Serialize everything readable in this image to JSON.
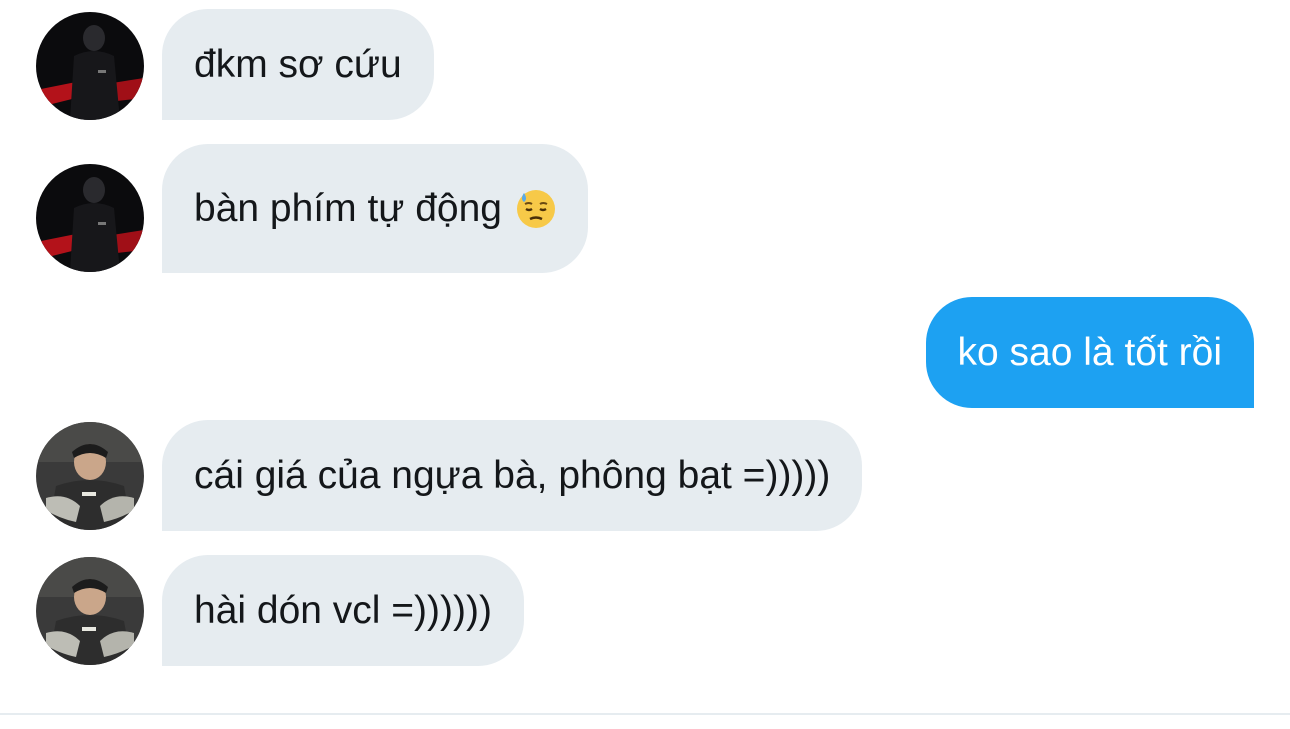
{
  "messages": [
    {
      "sender": "other",
      "avatar": "avatar-1",
      "text": "đkm sơ cứu"
    },
    {
      "sender": "other",
      "avatar": "avatar-1",
      "text": "bàn phím tự động",
      "emoji": "downcast-sweat-face"
    },
    {
      "sender": "me",
      "text": "ko sao là tốt rồi"
    },
    {
      "sender": "other",
      "avatar": "avatar-2",
      "text": "cái giá của ngựa bà, phông bạt =)))))"
    },
    {
      "sender": "other",
      "avatar": "avatar-2",
      "text": "hài dón vcl =))))))"
    }
  ],
  "colors": {
    "incoming_bubble": "#e6ecf0",
    "outgoing_bubble": "#1da1f2",
    "incoming_text": "#14171a",
    "outgoing_text": "#ffffff"
  }
}
